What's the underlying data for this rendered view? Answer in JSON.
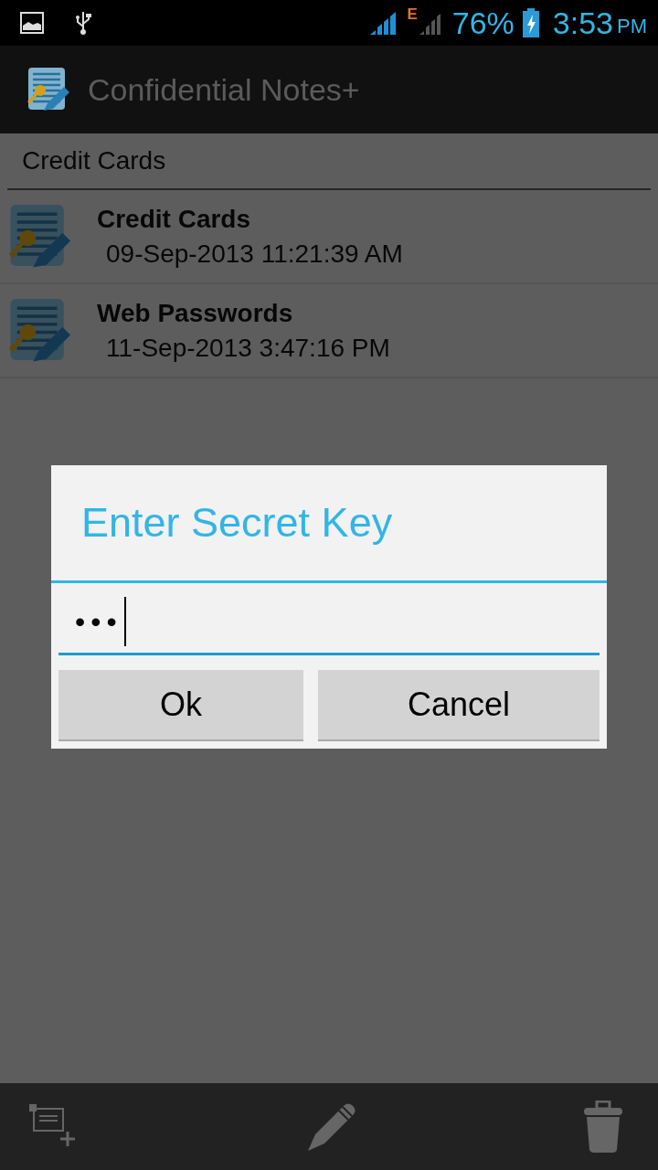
{
  "status_bar": {
    "battery": "76%",
    "time": "3:53",
    "ampm": "PM",
    "network": "E"
  },
  "app_bar": {
    "title": "Confidential Notes+"
  },
  "category": {
    "value": "Credit Cards"
  },
  "notes": [
    {
      "title": "Credit Cards",
      "date": "09-Sep-2013 11:21:39 AM"
    },
    {
      "title": "Web Passwords",
      "date": "11-Sep-2013 3:47:16 PM"
    }
  ],
  "dialog": {
    "title": "Enter Secret Key",
    "field": {
      "value": "•••"
    },
    "buttons": [
      {
        "label": "Ok"
      },
      {
        "label": "Cancel"
      }
    ]
  }
}
